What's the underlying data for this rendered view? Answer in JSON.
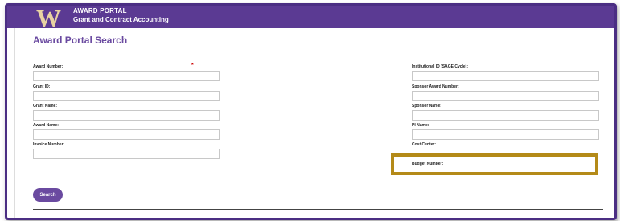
{
  "header": {
    "logo_letter": "W",
    "title": "AWARD PORTAL",
    "subtitle": "Grant and Contract Accounting"
  },
  "page_title": "Award Portal Search",
  "required_marker": "*",
  "left_fields": [
    {
      "label": "Award Number:",
      "value": ""
    },
    {
      "label": "Grant ID:",
      "value": ""
    },
    {
      "label": "Grant Name:",
      "value": ""
    },
    {
      "label": "Award Name:",
      "value": ""
    },
    {
      "label": "Invoice Number:",
      "value": ""
    }
  ],
  "right_fields": [
    {
      "label": "Institutional ID (SAGE Cycle):",
      "value": ""
    },
    {
      "label": "Sponsor Award Number:",
      "value": ""
    },
    {
      "label": "Sponsor Name:",
      "value": ""
    },
    {
      "label": "PI Name:",
      "value": ""
    },
    {
      "label": "Cost Center:",
      "value": ""
    },
    {
      "label": "Budget Number:",
      "value": ""
    }
  ],
  "search_button": "Search",
  "colors": {
    "brand_purple": "#5b3a93",
    "accent_gold": "#b48a18",
    "logo_gold": "#e8d3a2"
  }
}
